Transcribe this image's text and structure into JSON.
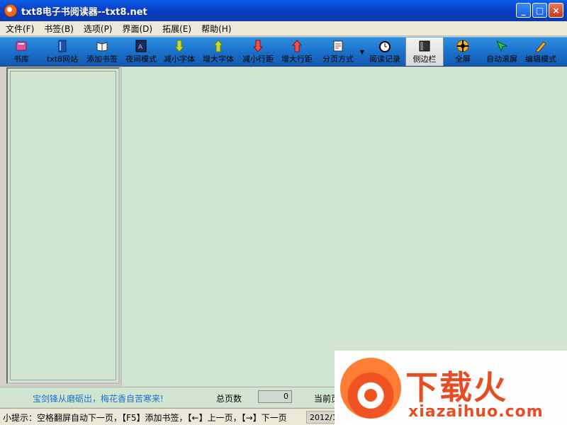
{
  "window": {
    "title": "txt8电子书阅读器--txt8.net",
    "minimize": "_",
    "maximize": "□",
    "close": "×"
  },
  "menu": [
    {
      "label": "文件(F)"
    },
    {
      "label": "书签(B)"
    },
    {
      "label": "选项(P)"
    },
    {
      "label": "界面(D)"
    },
    {
      "label": "拓展(E)"
    },
    {
      "label": "帮助(H)"
    }
  ],
  "toolbar": [
    {
      "label": "书库",
      "icon": "books-icon"
    },
    {
      "label": "txt8网站",
      "icon": "website-icon"
    },
    {
      "label": "添加书签",
      "icon": "add-bookmark-icon"
    },
    {
      "label": "夜间模式",
      "icon": "night-mode-icon"
    },
    {
      "label": "减小字体",
      "icon": "decrease-font-icon"
    },
    {
      "label": "增大字体",
      "icon": "increase-font-icon"
    },
    {
      "label": "减小行距",
      "icon": "decrease-spacing-icon"
    },
    {
      "label": "增大行距",
      "icon": "increase-spacing-icon"
    },
    {
      "label": "分页方式",
      "icon": "pagination-icon"
    },
    {
      "label": "阅读记录",
      "icon": "history-clock-icon"
    },
    {
      "label": "侧边栏",
      "icon": "sidebar-icon",
      "active": true
    },
    {
      "label": "全屏",
      "icon": "fullscreen-icon"
    },
    {
      "label": "自动滚屏",
      "icon": "auto-scroll-icon"
    },
    {
      "label": "编辑模式",
      "icon": "edit-pencil-icon"
    }
  ],
  "info": {
    "motto": "宝剑锋从磨砺出，梅花香自苦寒来!",
    "total_pages_label": "总页数",
    "total_pages_value": "0",
    "current_page_label": "当前页"
  },
  "status": {
    "hint": "小提示：空格翻屏自动下一页，【F5】添加书签，【←】上一页，【→】下一页",
    "date": "2012/10/18"
  },
  "watermark": {
    "title": "下载火",
    "domain": "xiazaihuo.com"
  },
  "colors": {
    "reading_background": "#cfe5cf",
    "toolbar_blue": "#1a6fc9",
    "titlebar_blue": "#0a3fc6",
    "motto_blue": "#1f6fd0",
    "watermark_orange": "#e8471f"
  }
}
